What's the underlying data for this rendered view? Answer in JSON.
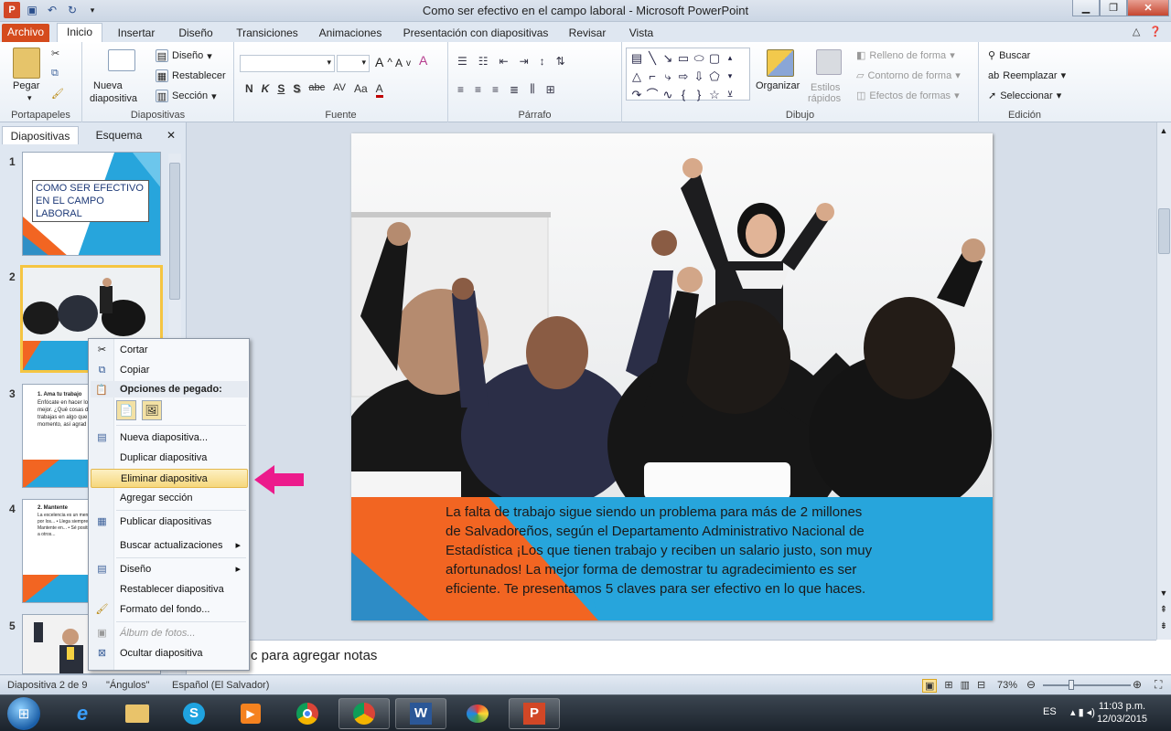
{
  "window": {
    "title": "Como ser efectivo en el campo laboral  -  Microsoft PowerPoint",
    "app_icon": "P"
  },
  "tabs": [
    "Archivo",
    "Inicio",
    "Insertar",
    "Diseño",
    "Transiciones",
    "Animaciones",
    "Presentación con diapositivas",
    "Revisar",
    "Vista"
  ],
  "ribbon": {
    "groups": {
      "clipboard": "Portapapeles",
      "slides": "Diapositivas",
      "font": "Fuente",
      "paragraph": "Párrafo",
      "drawing": "Dibujo",
      "editing": "Edición"
    },
    "paste": "Pegar",
    "new_slide_1": "Nueva",
    "new_slide_2": "diapositiva",
    "layout": "Diseño",
    "reset": "Restablecer",
    "section": "Sección",
    "bold": "N",
    "italic": "K",
    "underline": "S",
    "shadow": "S",
    "strike": "abc",
    "spacing": "AV",
    "case": "Aa",
    "grow": "A",
    "shrink": "A",
    "arrange": "Organizar",
    "quick_styles_1": "Estilos",
    "quick_styles_2": "rápidos",
    "shape_fill": "Relleno de forma",
    "shape_outline": "Contorno de forma",
    "shape_effects": "Efectos de formas",
    "find": "Buscar",
    "replace": "Reemplazar",
    "select": "Seleccionar"
  },
  "panel": {
    "tab_slides": "Diapositivas",
    "tab_outline": "Esquema",
    "close": "✕"
  },
  "thumbnails": [
    {
      "num": "1",
      "title": "COMO  SER EFECTIVO  EN EL CAMPO  LABORAL"
    },
    {
      "num": "2"
    },
    {
      "num": "3",
      "title": "1.  Ama tu trabajo",
      "body": "Enfócate en hacer lo contrario vivirás frus mejor. ¿Qué cosas disfrutas hacer? ¿C no trabajas en algo que te ayude a tom momento, así agrad pero no te conform"
    },
    {
      "num": "4",
      "title": "2.  Mantente",
      "body": "La excelencia es un mensaje. Si... • Sala actualizar por los... • Llega siempre y... • Dale por buscar... • Mantente en... • Sé positivo... • Sé servicial... • Ayuda a otros..."
    },
    {
      "num": "5"
    }
  ],
  "slide": {
    "text": "La falta de trabajo sigue siendo un problema para más de 2 millones de Salvadoreños, según el Departamento Administrativo Nacional de Estadística ¡Los que tienen trabajo y reciben un salario justo, son muy afortunados! La mejor forma de demostrar tu agradecimiento es ser  eficiente. Te presentamos 5 claves para ser efectivo en lo que haces."
  },
  "notes": {
    "placeholder": "Haga clic para agregar notas",
    "visible_fragment": "c para agregar notas"
  },
  "context_menu": {
    "cut": "Cortar",
    "copy": "Copiar",
    "paste_options": "Opciones de pegado:",
    "new_slide": "Nueva diapositiva...",
    "duplicate": "Duplicar diapositiva",
    "delete": "Eliminar diapositiva",
    "add_section": "Agregar sección",
    "publish": "Publicar diapositivas",
    "check_updates": "Buscar actualizaciones",
    "layout": "Diseño",
    "reset": "Restablecer diapositiva",
    "format_bg": "Formato del fondo...",
    "photo_album": "Álbum de fotos...",
    "hide": "Ocultar diapositiva",
    "highlighted": "Eliminar diapositiva"
  },
  "status": {
    "slide_pos": "Diapositiva 2 de 9",
    "theme": "\"Ángulos\"",
    "language": "Español (El Salvador)",
    "zoom": "73%"
  },
  "taskbar": {
    "lang": "ES",
    "time": "11:03 p.m.",
    "date": "12/03/2015"
  },
  "colors": {
    "accent_blue": "#27a5dc",
    "accent_orange": "#f26522",
    "file_tab": "#d54b1d",
    "highlight": "#f6d77c",
    "annotation_arrow": "#ec1b8c"
  }
}
